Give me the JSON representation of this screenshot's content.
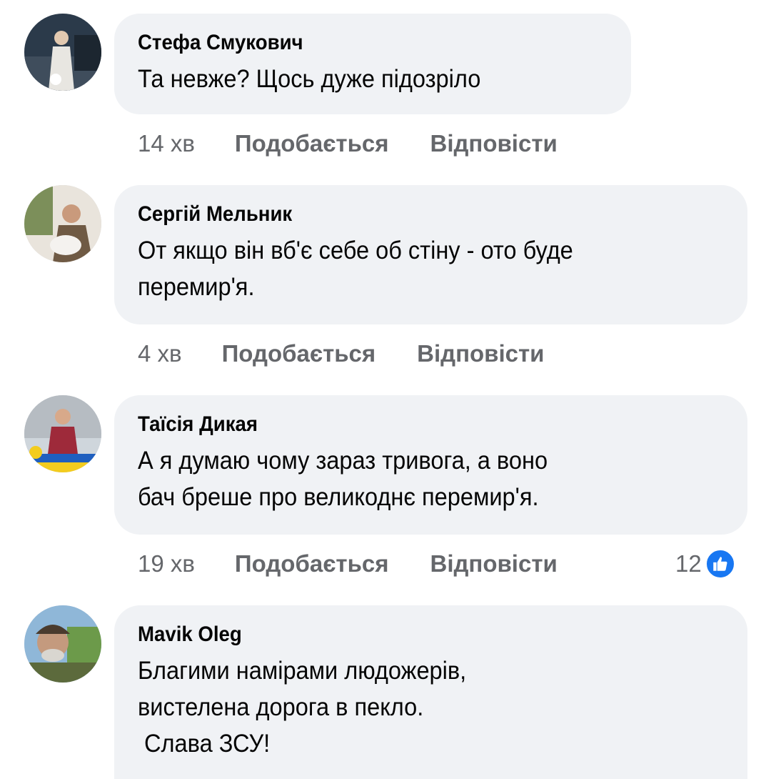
{
  "colors": {
    "bubble": "#f0f2f5",
    "meta_text": "#65676b",
    "like_badge": "#1877f2"
  },
  "comments": [
    {
      "author": "Стефа Смукович",
      "lines": [
        "Та невже? Щось дуже підозріло"
      ],
      "time": "14 хв",
      "like_label": "Подобається",
      "reply_label": "Відповісти"
    },
    {
      "author": "Сергій Мельник",
      "lines": [
        "От якщо він вб'є себе об стіну - ото буде",
        "перемир'я."
      ],
      "time": "4 хв",
      "like_label": "Подобається",
      "reply_label": "Відповісти"
    },
    {
      "author": "Таїсія Дикая",
      "lines": [
        "А я думаю чому зараз тривога, а воно",
        "бач бреше про великоднє перемир'я."
      ],
      "time": "19 хв",
      "like_label": "Подобається",
      "reply_label": "Відповісти",
      "reaction_count": "12",
      "reaction_icon": "like-icon"
    },
    {
      "author": "Mavik Oleg",
      "lines": [
        "Благими намірами людожерів,",
        "вистелена дорога в пекло.",
        " Слава ЗСУ!"
      ]
    }
  ]
}
